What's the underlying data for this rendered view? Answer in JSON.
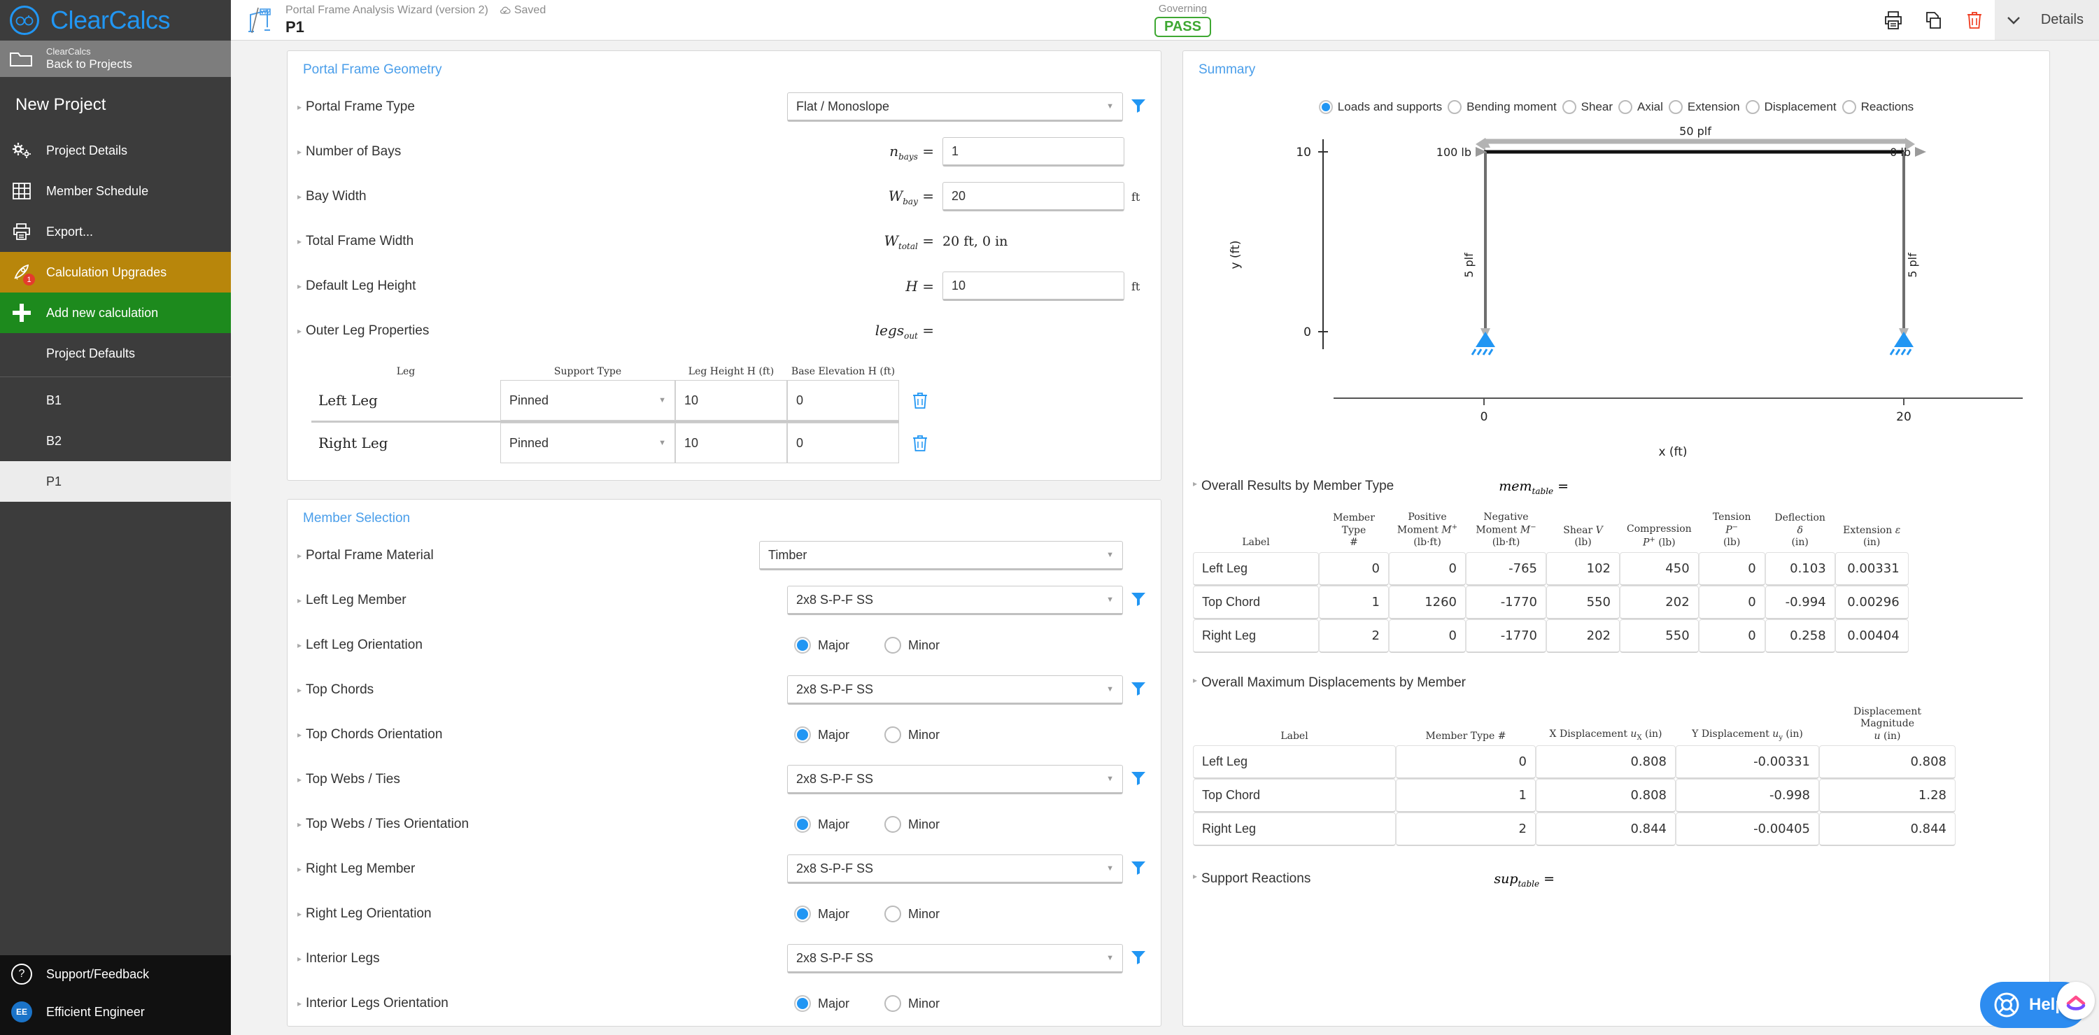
{
  "brand": {
    "name": "ClearCalcs",
    "logo_icon": "glasses-logo-icon",
    "accent": "#2196f3"
  },
  "topbar": {
    "calc_subtitle": "Portal Frame Analysis Wizard (version 2)",
    "saved_label": "Saved",
    "calc_name": "P1",
    "governing_label": "Governing",
    "governing_status": "PASS",
    "governing_color": "#3ea832",
    "details_label": "Details",
    "icons": [
      "print-icon",
      "copy-icon",
      "trash-icon",
      "chevron-down-icon"
    ]
  },
  "sidebar": {
    "back": {
      "small": "ClearCalcs",
      "big": "Back to Projects"
    },
    "project_name": "New Project",
    "items": [
      {
        "label": "Project Details",
        "icon": "gears-icon"
      },
      {
        "label": "Member Schedule",
        "icon": "grid-icon"
      },
      {
        "label": "Export...",
        "icon": "printer-icon"
      },
      {
        "label": "Calculation Upgrades",
        "icon": "rocket-icon",
        "badge": "1"
      },
      {
        "label": "Add new calculation",
        "icon": "plus-icon"
      }
    ],
    "sub_items": [
      {
        "label": "Project Defaults",
        "active": false
      },
      {
        "label": "B1",
        "active": false
      },
      {
        "label": "B2",
        "active": false
      },
      {
        "label": "P1",
        "active": true
      }
    ],
    "bottom": [
      {
        "label": "Support/Feedback",
        "icon": "question-circle-icon"
      },
      {
        "label": "Efficient Engineer",
        "icon": "avatar-icon",
        "initials": "EE"
      }
    ]
  },
  "geometry": {
    "title": "Portal Frame Geometry",
    "rows": [
      {
        "label": "Portal Frame Type",
        "symbol": "",
        "type": "select",
        "value": "Flat / Monoslope",
        "unit": "",
        "filter": true
      },
      {
        "label": "Number of Bays",
        "symbol": "n",
        "sub": "bays",
        "type": "input",
        "value": "1",
        "unit": "",
        "filter": false
      },
      {
        "label": "Bay Width",
        "symbol": "W",
        "sub": "bay",
        "type": "input",
        "value": "20",
        "unit": "ft",
        "filter": false
      },
      {
        "label": "Total Frame Width",
        "symbol": "W",
        "sub": "total",
        "type": "static",
        "value": "20 ft, 0 in",
        "unit": "",
        "filter": false
      },
      {
        "label": "Default Leg Height",
        "symbol": "H",
        "sub": "",
        "type": "input",
        "value": "10",
        "unit": "ft",
        "filter": false
      },
      {
        "label": "Outer Leg Properties",
        "symbol": "legs",
        "sub": "out",
        "type": "none",
        "value": "",
        "unit": "",
        "filter": false
      }
    ],
    "legs_table": {
      "headers": [
        "Leg",
        "Support Type",
        "Leg Height H (ft)",
        "Base Elevation H (ft)"
      ],
      "rows": [
        {
          "leg": "Left Leg",
          "support": "Pinned",
          "height": "10",
          "base": "0"
        },
        {
          "leg": "Right Leg",
          "support": "Pinned",
          "height": "10",
          "base": "0"
        }
      ]
    }
  },
  "member_selection": {
    "title": "Member Selection",
    "rows": [
      {
        "label": "Portal Frame Material",
        "type": "select",
        "value": "Timber",
        "filter": false,
        "wide": true
      },
      {
        "label": "Left Leg Member",
        "type": "select",
        "value": "2x8 S-P-F SS",
        "filter": true
      },
      {
        "label": "Left Leg Orientation",
        "type": "radio",
        "options": [
          "Major",
          "Minor"
        ],
        "selected": "Major"
      },
      {
        "label": "Top Chords",
        "type": "select",
        "value": "2x8 S-P-F SS",
        "filter": true
      },
      {
        "label": "Top Chords Orientation",
        "type": "radio",
        "options": [
          "Major",
          "Minor"
        ],
        "selected": "Major"
      },
      {
        "label": "Top Webs / Ties",
        "type": "select",
        "value": "2x8 S-P-F SS",
        "filter": true
      },
      {
        "label": "Top Webs / Ties Orientation",
        "type": "radio",
        "options": [
          "Major",
          "Minor"
        ],
        "selected": "Major"
      },
      {
        "label": "Right Leg Member",
        "type": "select",
        "value": "2x8 S-P-F SS",
        "filter": true
      },
      {
        "label": "Right Leg Orientation",
        "type": "radio",
        "options": [
          "Major",
          "Minor"
        ],
        "selected": "Major"
      },
      {
        "label": "Interior Legs",
        "type": "select",
        "value": "2x8 S-P-F SS",
        "filter": true
      },
      {
        "label": "Interior Legs Orientation",
        "type": "radio",
        "options": [
          "Major",
          "Minor"
        ],
        "selected": "Major"
      }
    ]
  },
  "summary": {
    "title": "Summary",
    "view_options": [
      "Loads and supports",
      "Bending moment",
      "Shear",
      "Axial",
      "Extension",
      "Displacement",
      "Reactions"
    ],
    "selected_view": "Loads and supports"
  },
  "chart_data": {
    "type": "diagram",
    "title": "",
    "xlabel": "x (ft)",
    "ylabel": "y (ft)",
    "xlim": [
      0,
      20
    ],
    "ylim": [
      0,
      10
    ],
    "xticks": [
      "0",
      "20"
    ],
    "yticks": [
      "0",
      "10"
    ],
    "annotations": [
      {
        "text": "50 plf",
        "position": "top-chord-udl"
      },
      {
        "text": "100 lb",
        "position": "top-left-point-load"
      },
      {
        "text": "0 lb",
        "position": "top-right-point-load"
      },
      {
        "text": "5 plf",
        "position": "left-leg-udl"
      },
      {
        "text": "5 plf",
        "position": "right-leg-udl"
      }
    ],
    "supports": [
      {
        "type": "pinned",
        "x": 0,
        "y": 0
      },
      {
        "type": "pinned",
        "x": 20,
        "y": 0
      }
    ],
    "members": [
      {
        "name": "Left Leg",
        "from": [
          0,
          0
        ],
        "to": [
          0,
          10
        ]
      },
      {
        "name": "Top Chord",
        "from": [
          0,
          10
        ],
        "to": [
          20,
          10
        ]
      },
      {
        "name": "Right Leg",
        "from": [
          20,
          0
        ],
        "to": [
          20,
          10
        ]
      }
    ]
  },
  "results_members": {
    "title": "Overall Results by Member Type",
    "symbol": "mem",
    "symbol_sub": "table",
    "headers": [
      "Label",
      "Member Type #",
      "Positive Moment M⁺ (lb·ft)",
      "Negative Moment M⁻ (lb·ft)",
      "Shear V (lb)",
      "Compression P⁺ (lb)",
      "Tension P⁻ (lb)",
      "Deflection δ (in)",
      "Extension ε (in)"
    ],
    "rows": [
      {
        "label": "Left Leg",
        "type": "0",
        "mpos": "0",
        "mneg": "-765",
        "shear": "102",
        "comp": "450",
        "tens": "0",
        "defl": "0.103",
        "ext": "0.00331"
      },
      {
        "label": "Top Chord",
        "type": "1",
        "mpos": "1260",
        "mneg": "-1770",
        "shear": "550",
        "comp": "202",
        "tens": "0",
        "defl": "-0.994",
        "ext": "0.00296"
      },
      {
        "label": "Right Leg",
        "type": "2",
        "mpos": "0",
        "mneg": "-1770",
        "shear": "202",
        "comp": "550",
        "tens": "0",
        "defl": "0.258",
        "ext": "0.00404"
      }
    ]
  },
  "results_displacements": {
    "title": "Overall Maximum Displacements by Member",
    "headers": [
      "Label",
      "Member Type #",
      "X Displacement uₓ (in)",
      "Y Displacement u_y (in)",
      "Displacement Magnitude u (in)"
    ],
    "rows": [
      {
        "label": "Left Leg",
        "type": "0",
        "ux": "0.808",
        "uy": "-0.00331",
        "umag": "0.808"
      },
      {
        "label": "Top Chord",
        "type": "1",
        "ux": "0.808",
        "uy": "-0.998",
        "umag": "1.28"
      },
      {
        "label": "Right Leg",
        "type": "2",
        "ux": "0.844",
        "uy": "-0.00405",
        "umag": "0.844"
      }
    ]
  },
  "support_reactions": {
    "title": "Support Reactions",
    "symbol": "sup",
    "symbol_sub": "table"
  },
  "help": {
    "label": "Help",
    "icon": "lifebuoy-icon"
  }
}
